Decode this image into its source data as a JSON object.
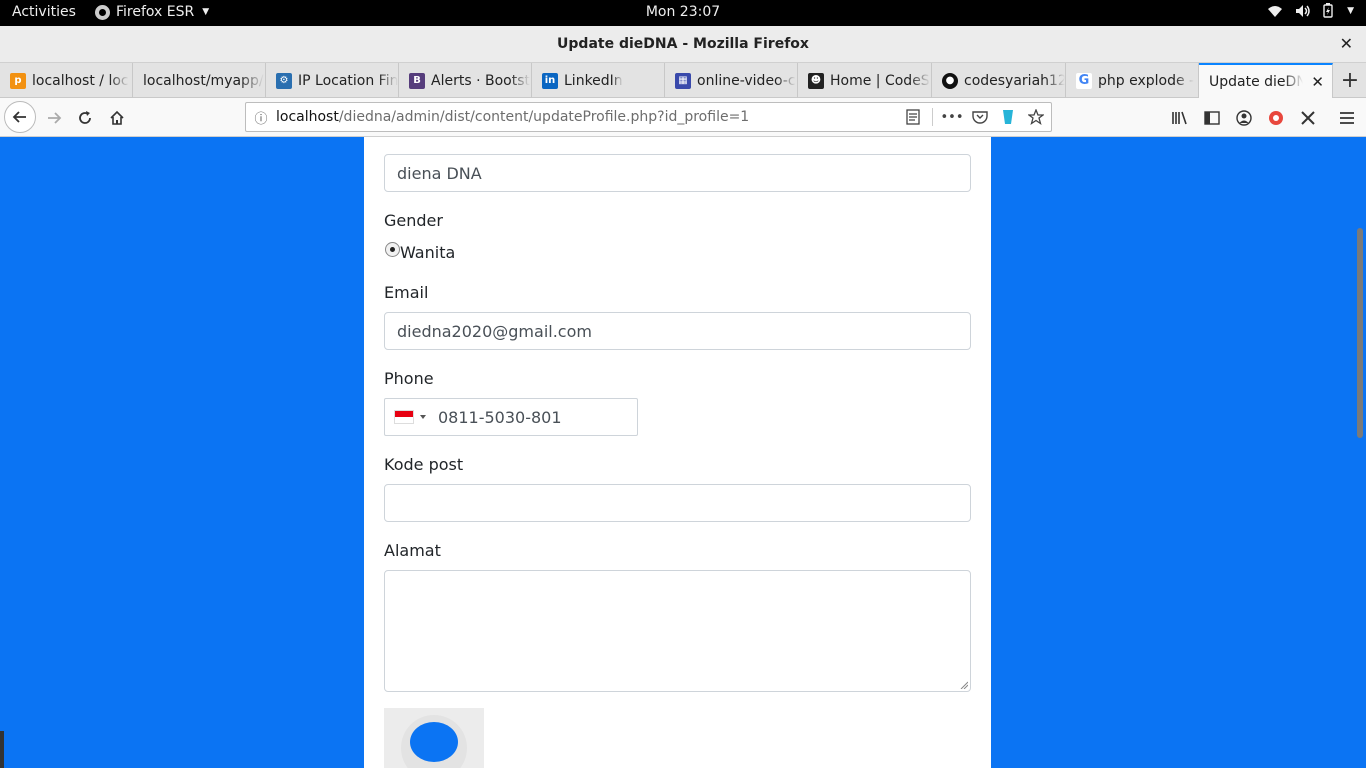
{
  "system_bar": {
    "activities": "Activities",
    "app_name": "Firefox ESR",
    "clock": "Mon 23:07"
  },
  "window": {
    "title": "Update dieDNA - Mozilla Firefox",
    "close": "✕"
  },
  "tabs": [
    {
      "label": "localhost / loc",
      "icon": "phpmyadmin-icon",
      "color": "#f29111"
    },
    {
      "label": "localhost/myapp/",
      "icon": "none"
    },
    {
      "label": "IP Location Fin",
      "icon": "ip-location-icon",
      "color": "#2a6fb0"
    },
    {
      "label": "Alerts · Bootst",
      "icon": "bootstrap-icon",
      "color": "#563d7c"
    },
    {
      "label": "LinkedIn",
      "icon": "linkedin-icon",
      "color": "#0a66c2"
    },
    {
      "label": "online-video-c",
      "icon": "video-converter-icon",
      "color": "#3949ab"
    },
    {
      "label": "Home | CodeS",
      "icon": "codes-icon",
      "color": "#222222"
    },
    {
      "label": "codesyariah12",
      "icon": "github-icon",
      "color": "#111111"
    },
    {
      "label": "php explode -",
      "icon": "google-icon",
      "color": "#4285f4"
    },
    {
      "label": "Update dieDNA",
      "icon": "none",
      "active": true
    }
  ],
  "url": {
    "host": "localhost",
    "path": "/diedna/admin/dist/content/updateProfile.php?id_profile=1"
  },
  "form": {
    "fullname_value": "diena DNA",
    "gender_label": "Gender",
    "gender_option": "Wanita",
    "email_label": "Email",
    "email_value": "diedna2020@gmail.com",
    "phone_label": "Phone",
    "phone_value": "0811-5030-801",
    "phone_country": "Indonesia",
    "kodepost_label": "Kode post",
    "kodepost_value": "",
    "alamat_label": "Alamat",
    "alamat_value": ""
  },
  "colors": {
    "page_background": "#0b74f3",
    "accent": "#0a84ff"
  }
}
